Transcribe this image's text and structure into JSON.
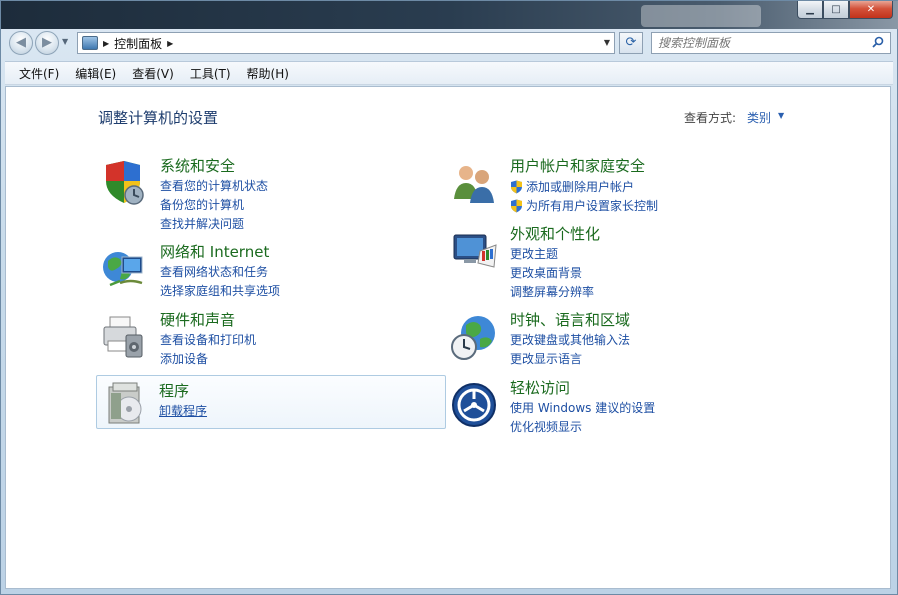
{
  "window": {
    "caption": {
      "minimize": "▁",
      "maximize": "□",
      "close": "✕"
    }
  },
  "nav": {
    "back": "◀",
    "forward": "▶",
    "breadcrumb": "控制面板",
    "search_placeholder": "搜索控制面板"
  },
  "menu": [
    "文件(F)",
    "编辑(E)",
    "查看(V)",
    "工具(T)",
    "帮助(H)"
  ],
  "content": {
    "title": "调整计算机的设置",
    "view_by_label": "查看方式:",
    "view_by_value": "类别"
  },
  "categories": [
    {
      "title": "系统和安全",
      "links": [
        "查看您的计算机状态",
        "备份您的计算机",
        "查找并解决问题"
      ]
    },
    {
      "title": "网络和 Internet",
      "links": [
        "查看网络状态和任务",
        "选择家庭组和共享选项"
      ]
    },
    {
      "title": "硬件和声音",
      "links": [
        "查看设备和打印机",
        "添加设备"
      ]
    },
    {
      "title": "程序",
      "links": [
        "卸载程序"
      ]
    },
    {
      "title": "用户帐户和家庭安全",
      "links": [
        "添加或删除用户帐户",
        "为所有用户设置家长控制"
      ]
    },
    {
      "title": "外观和个性化",
      "links": [
        "更改主题",
        "更改桌面背景",
        "调整屏幕分辨率"
      ]
    },
    {
      "title": "时钟、语言和区域",
      "links": [
        "更改键盘或其他输入法",
        "更改显示语言"
      ]
    },
    {
      "title": "轻松访问",
      "links": [
        "使用 Windows 建议的设置",
        "优化视频显示"
      ]
    }
  ],
  "colors": {
    "category_title": "#1a6a1e",
    "link": "#1e4fa3",
    "page_title": "#1e3d6e"
  }
}
